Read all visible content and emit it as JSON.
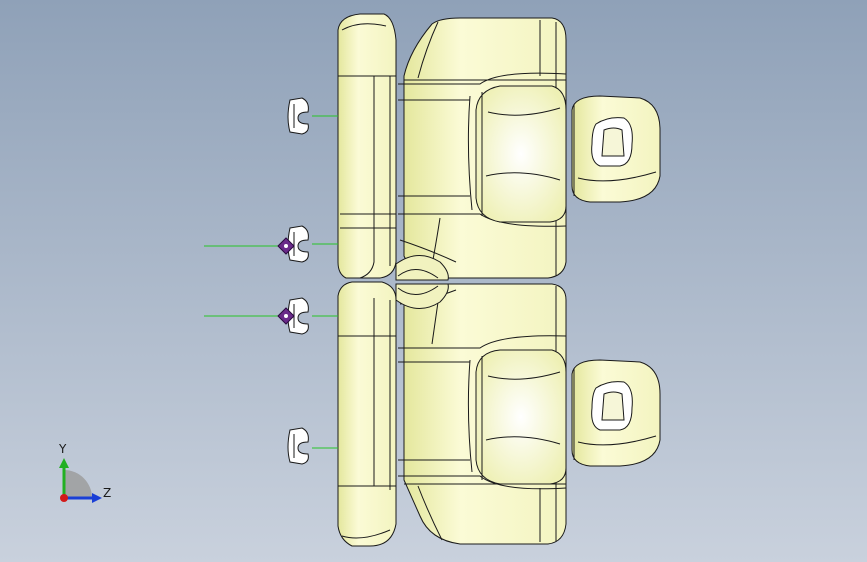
{
  "viewport": {
    "background_top": "#8fa1b8",
    "background_bottom": "#c9d1dd",
    "part_fill": "#fbfbd6",
    "part_fill_shade": "#e4e79d",
    "edge_color": "#1a1a1a",
    "clip_fill": "#ffffff",
    "leader_color": "#28c428",
    "constraint_color": "#6a2a8a"
  },
  "triad": {
    "y_label": "Y",
    "z_label": "Z",
    "y_color": "#22b022",
    "z_color": "#1a3fd6",
    "x_color": "#d21a1a"
  }
}
